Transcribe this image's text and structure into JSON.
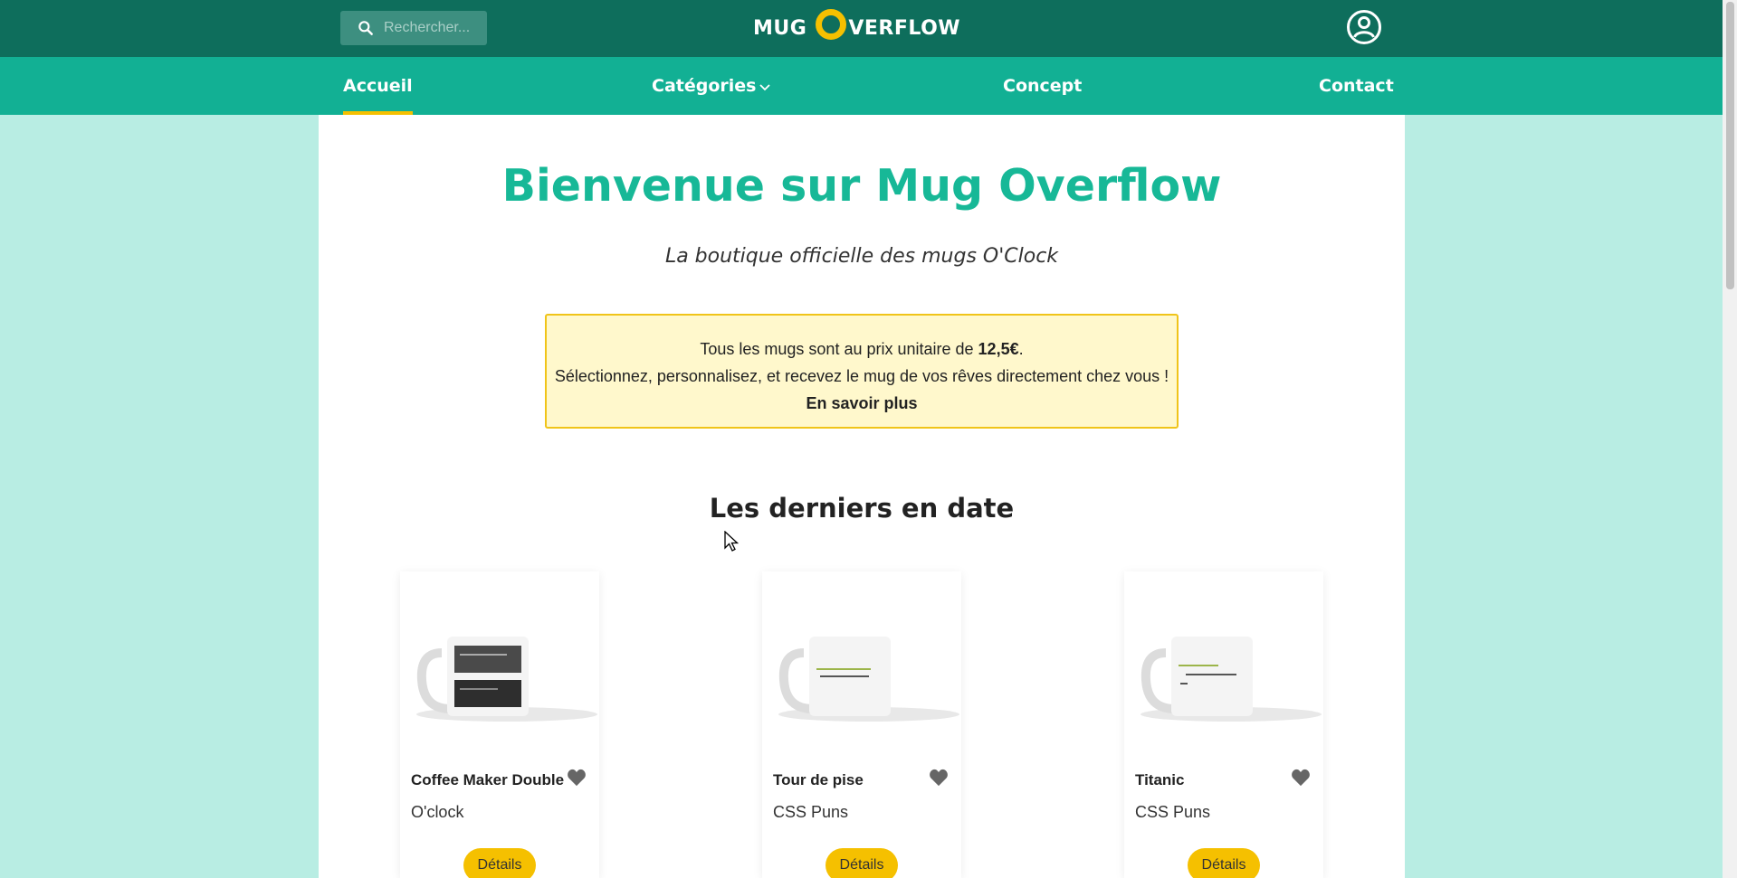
{
  "search": {
    "placeholder": "Rechercher..."
  },
  "logo": {
    "part1": "MUG",
    "part2": "VERFLOW"
  },
  "nav": {
    "items": [
      {
        "label": "Accueil"
      },
      {
        "label": "Catégories"
      },
      {
        "label": "Concept"
      },
      {
        "label": "Contact"
      }
    ]
  },
  "hero": {
    "title": "Bienvenue sur Mug Overflow",
    "subtitle": "La boutique officielle des mugs O'Clock"
  },
  "notice": {
    "line1_prefix": "Tous les mugs sont au prix unitaire de ",
    "price": "12,5€",
    "line1_suffix": ".",
    "line2": "Sélectionnez, personnalisez, et recevez le mug de vos rêves directement chez vous !",
    "link": "En savoir plus"
  },
  "section": {
    "title": "Les derniers en date"
  },
  "products": [
    {
      "name": "Coffee Maker Double",
      "brand": "O'clock",
      "button": "Détails"
    },
    {
      "name": "Tour de pise",
      "brand": "CSS Puns",
      "button": "Détails"
    },
    {
      "name": "Titanic",
      "brand": "CSS Puns",
      "button": "Détails"
    }
  ],
  "colors": {
    "topbar": "#0e6e5c",
    "navbar": "#12b094",
    "accent": "#f5c000",
    "title": "#17b897",
    "background": "#b8ede3"
  }
}
